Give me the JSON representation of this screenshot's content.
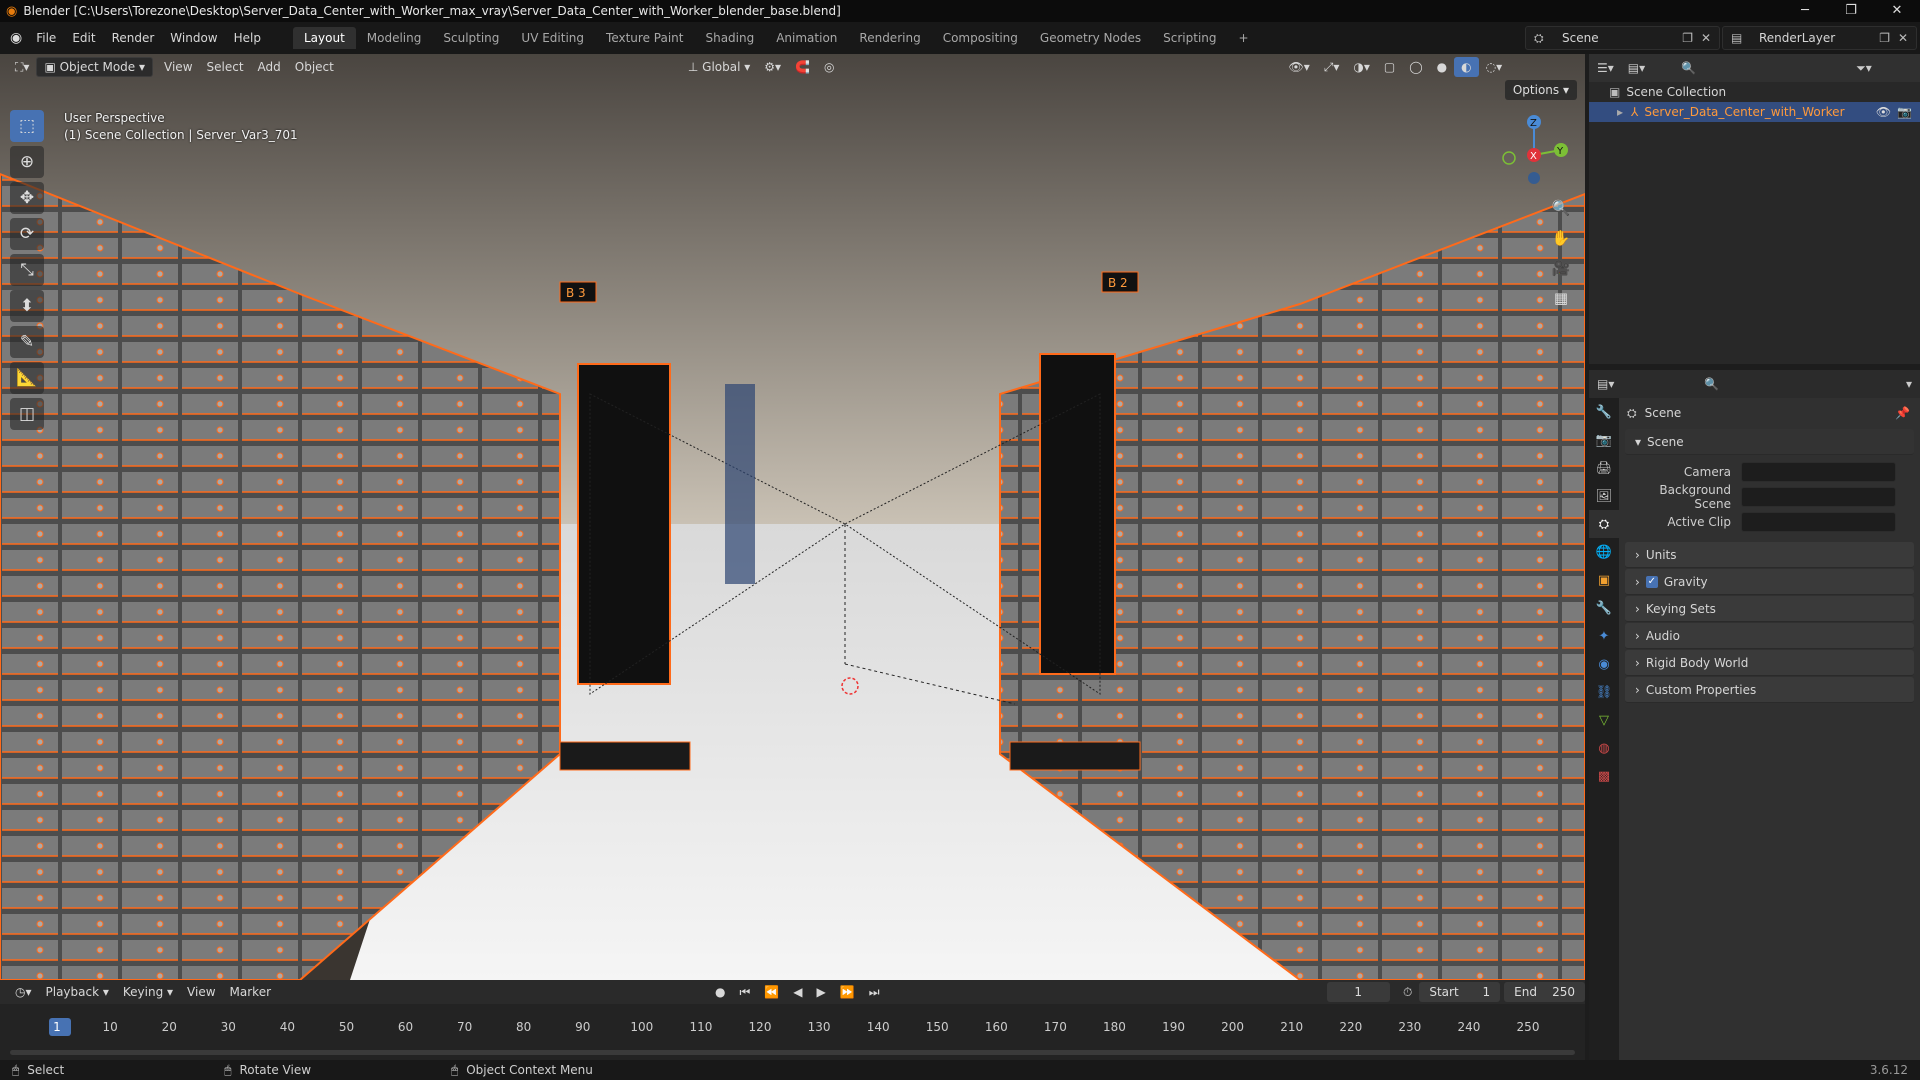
{
  "window": {
    "title": "Blender [C:\\Users\\Torezone\\Desktop\\Server_Data_Center_with_Worker_max_vray\\Server_Data_Center_with_Worker_blender_base.blend]",
    "minimize": "─",
    "restore": "❐",
    "close": "✕"
  },
  "menu": {
    "items": [
      "File",
      "Edit",
      "Render",
      "Window",
      "Help"
    ],
    "workspaces": [
      "Layout",
      "Modeling",
      "Sculpting",
      "UV Editing",
      "Texture Paint",
      "Shading",
      "Animation",
      "Rendering",
      "Compositing",
      "Geometry Nodes",
      "Scripting"
    ],
    "active_workspace": "Layout",
    "add_workspace": "+",
    "scene": "Scene",
    "render_layer": "RenderLayer"
  },
  "viewport": {
    "mode": "Object Mode",
    "menus": [
      "View",
      "Select",
      "Add",
      "Object"
    ],
    "transform_orientation": "Global",
    "options": "Options",
    "overlay_line1": "User Perspective",
    "overlay_line2": "(1) Scene Collection | Server_Var3_701",
    "gizmo": {
      "z": "Z",
      "x": "X",
      "y": "Y"
    },
    "rack_labels": [
      "B 3",
      "B 2"
    ]
  },
  "outliner": {
    "root": "Scene Collection",
    "item": "Server_Data_Center_with_Worker"
  },
  "properties": {
    "context": "Scene",
    "panel_title": "Scene",
    "fields": [
      {
        "label": "Camera"
      },
      {
        "label": "Background Scene"
      },
      {
        "label": "Active Clip"
      }
    ],
    "subpanels": [
      "Units",
      "Gravity",
      "Keying Sets",
      "Audio",
      "Rigid Body World",
      "Custom Properties"
    ]
  },
  "timeline": {
    "menus": [
      "Playback",
      "Keying",
      "View",
      "Marker"
    ],
    "current_frame": "1",
    "start_label": "Start",
    "start_value": "1",
    "end_label": "End",
    "end_value": "250",
    "ticks": [
      "1",
      "10",
      "20",
      "30",
      "40",
      "50",
      "60",
      "70",
      "80",
      "90",
      "100",
      "110",
      "120",
      "130",
      "140",
      "150",
      "160",
      "170",
      "180",
      "190",
      "200",
      "210",
      "220",
      "230",
      "240",
      "250"
    ]
  },
  "status": {
    "select": "Select",
    "rotate": "Rotate View",
    "context_menu": "Object Context Menu",
    "version": "3.6.12"
  },
  "colors": {
    "accent": "#4772b3",
    "selection_orange": "#ff6a1a",
    "outliner_item": "#ff9a3c"
  }
}
